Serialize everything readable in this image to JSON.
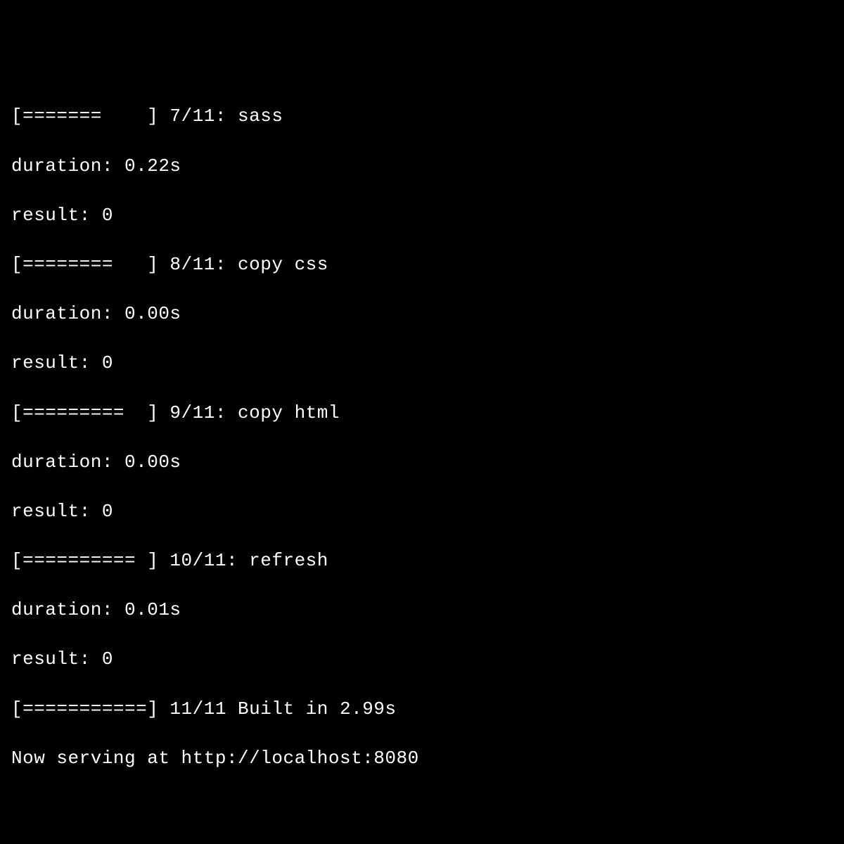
{
  "lines": [
    "[=======    ] 7/11: sass",
    "duration: 0.22s",
    "result: 0",
    "[========   ] 8/11: copy css",
    "duration: 0.00s",
    "result: 0",
    "[=========  ] 9/11: copy html",
    "duration: 0.00s",
    "result: 0",
    "[========== ] 10/11: refresh",
    "duration: 0.01s",
    "result: 0",
    "[===========] 11/11 Built in 2.99s",
    "Now serving at http://localhost:8080"
  ]
}
